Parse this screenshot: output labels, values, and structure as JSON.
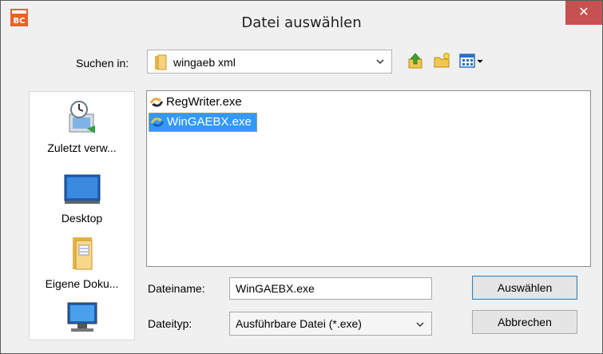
{
  "window": {
    "title": "Datei auswählen",
    "close_label": "✕"
  },
  "lookin": {
    "label": "Suchen in:",
    "value": "wingaeb xml"
  },
  "toolbar": {
    "icons": [
      "up-folder-icon",
      "new-folder-icon",
      "view-menu-icon"
    ]
  },
  "places": [
    {
      "label": "Zuletzt verw...",
      "icon": "recent-places-icon"
    },
    {
      "label": "Desktop",
      "icon": "desktop-icon"
    },
    {
      "label": "Eigene Doku...",
      "icon": "documents-folder-icon"
    },
    {
      "label": "",
      "icon": "computer-icon"
    }
  ],
  "files": [
    {
      "name": "RegWriter.exe",
      "selected": false
    },
    {
      "name": "WinGAEBX.exe",
      "selected": true
    }
  ],
  "filename": {
    "label": "Dateiname:",
    "value": "WinGAEBX.exe"
  },
  "filetype": {
    "label": "Dateityp:",
    "value": "Ausführbare Datei (*.exe)"
  },
  "buttons": {
    "ok": "Auswählen",
    "cancel": "Abbrechen"
  },
  "colors": {
    "selection": "#3399ff",
    "close": "#c75050"
  }
}
